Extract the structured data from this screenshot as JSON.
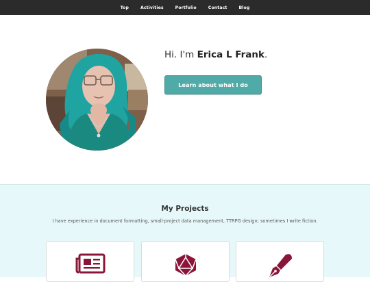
{
  "nav": {
    "items": [
      "Top",
      "Activities",
      "Portfolio",
      "Contact",
      "Blog"
    ]
  },
  "hero": {
    "greeting_prefix": "Hi. I'm ",
    "name": "Erica L Frank",
    "greeting_suffix": ".",
    "cta_label": "Learn about what I do"
  },
  "projects": {
    "title": "My Projects",
    "description": "I have experience in document formatting, small-project data management, TTRPG design; sometimes I write fiction.",
    "cards": [
      {
        "icon": "newspaper-icon"
      },
      {
        "icon": "d20-die-icon"
      },
      {
        "icon": "fountain-pen-icon"
      }
    ]
  },
  "colors": {
    "nav_bg": "#2b2b2b",
    "accent": "#4faaa8",
    "section_bg": "#e7f8fa",
    "icon": "#8b1538"
  }
}
